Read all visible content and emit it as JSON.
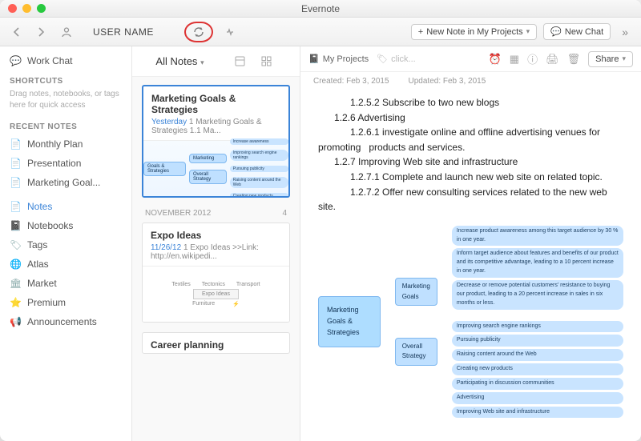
{
  "window": {
    "title": "Evernote"
  },
  "toolbar": {
    "username": "USER NAME",
    "new_note_label": "New Note in My Projects",
    "new_chat_label": "New Chat"
  },
  "sidebar": {
    "workchat": "Work Chat",
    "shortcuts_head": "SHORTCUTS",
    "shortcuts_hint": "Drag notes, notebooks, or tags here for quick access",
    "recent_head": "RECENT NOTES",
    "recent": [
      {
        "label": "Monthly Plan"
      },
      {
        "label": "Presentation"
      },
      {
        "label": "Marketing Goal..."
      }
    ],
    "nav": [
      {
        "label": "Notes",
        "icon": "📄",
        "active": true
      },
      {
        "label": "Notebooks",
        "icon": "📓"
      },
      {
        "label": "Tags",
        "icon": "🏷"
      },
      {
        "label": "Atlas",
        "icon": "🌐"
      },
      {
        "label": "Market",
        "icon": "🏛"
      },
      {
        "label": "Premium",
        "icon": "⭐"
      },
      {
        "label": "Announcements",
        "icon": "📢"
      }
    ]
  },
  "notelist": {
    "header": "All Notes",
    "month_head": "NOVEMBER 2012",
    "month_count": "4",
    "cards": [
      {
        "title": "Marketing Goals & Strategies",
        "date": "Yesterday",
        "sub": "1 Marketing Goals & Strategies 1.1 Ma..."
      },
      {
        "title": "Expo Ideas",
        "date": "11/26/12",
        "sub": "1 Expo Ideas >>Link: http://en.wikipedi..."
      },
      {
        "title": "Career planning",
        "date": "",
        "sub": ""
      }
    ]
  },
  "detail": {
    "crumb_notebook": "My Projects",
    "crumb_click": "click...",
    "share": "Share",
    "created_label": "Created:",
    "created_value": "Feb 3, 2015",
    "updated_label": "Updated:",
    "updated_value": "Feb 3, 2015",
    "body_lines": [
      "            1.2.5.2 Subscribe to two new blogs",
      "      1.2.6 Advertising",
      "            1.2.6.1 investigate online and offline advertising venues for promoting   products and services.",
      "      1.2.7 Improving Web site and infrastructure",
      "            1.2.7.1 Complete and launch new web site on related topic.",
      "            1.2.7.2 Offer new consulting services related to the new web site."
    ],
    "mindmap": {
      "root": "Marketing Goals & Strategies",
      "branch1": "Marketing Goals",
      "branch2": "Overall Strategy",
      "goals": [
        "Increase product awareness among this target audience by 30 % in one year.",
        "Inform target audience about features and benefits of our product and its competitive advantage, leading to a 10 percent increase in one year.",
        "Decrease or remove potential customers' resistance to buying our product, leading to a 20 percent increase in sales in six months or less."
      ],
      "strategies": [
        "Improving search engine rankings",
        "Pursuing publicity",
        "Raising content around the Web",
        "Creating new products",
        "Participating in discussion communities",
        "Advertising",
        "Improving Web site and infrastructure"
      ]
    }
  }
}
